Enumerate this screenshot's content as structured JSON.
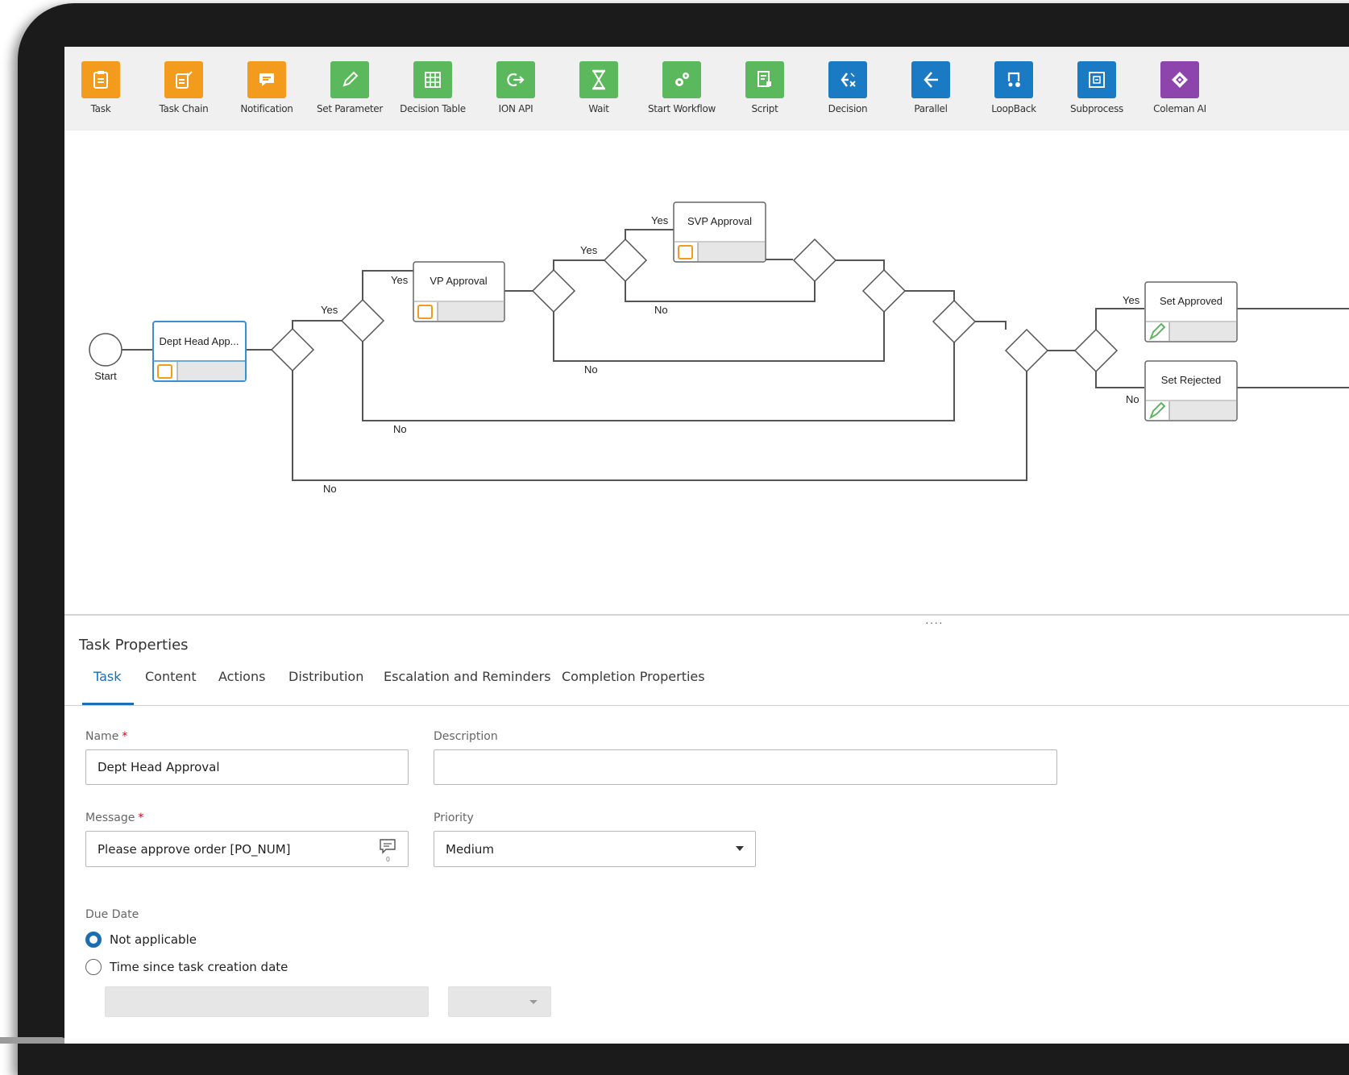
{
  "colors": {
    "orange": "#f29b1d",
    "green": "#5cb85c",
    "blue": "#1a7bc4",
    "purple": "#8e44ad",
    "active_tab": "#1a6fb3"
  },
  "toolbar": {
    "items": [
      {
        "label": "Task",
        "icon": "clipboard-icon"
      },
      {
        "label": "Task Chain",
        "icon": "task-chain-icon"
      },
      {
        "label": "Notification",
        "icon": "message-icon"
      },
      {
        "label": "Set Parameter",
        "icon": "pencil-icon"
      },
      {
        "label": "Decision Table",
        "icon": "grid-icon"
      },
      {
        "label": "ION API",
        "icon": "api-arrow-icon"
      },
      {
        "label": "Wait",
        "icon": "hourglass-icon"
      },
      {
        "label": "Start Workflow",
        "icon": "gears-icon"
      },
      {
        "label": "Script",
        "icon": "script-icon"
      },
      {
        "label": "Decision",
        "icon": "decision-icon"
      },
      {
        "label": "Parallel",
        "icon": "parallel-icon"
      },
      {
        "label": "LoopBack",
        "icon": "loopback-icon"
      },
      {
        "label": "Subprocess",
        "icon": "subprocess-icon"
      },
      {
        "label": "Coleman AI",
        "icon": "coleman-ai-icon"
      }
    ]
  },
  "diagram": {
    "start_label": "Start",
    "nodes": {
      "dept_head": "Dept Head App...",
      "vp": "VP Approval",
      "svp": "SVP Approval",
      "set_approved": "Set Approved",
      "set_rejected": "Set Rejected"
    },
    "yes": "Yes",
    "no": "No"
  },
  "properties": {
    "title": "Task Properties",
    "tabs": [
      "Task",
      "Content",
      "Actions",
      "Distribution",
      "Escalation and Reminders",
      "Completion Properties"
    ],
    "name_label": "Name",
    "name_value": "Dept Head Approval",
    "description_label": "Description",
    "description_value": "",
    "message_label": "Message",
    "message_value": "Please approve order [PO_NUM]",
    "message_count": "0",
    "priority_label": "Priority",
    "priority_value": "Medium",
    "required_mark": "*",
    "due_date_label": "Due Date",
    "due_options": [
      "Not applicable",
      "Time since task creation date"
    ],
    "grip": "····"
  }
}
